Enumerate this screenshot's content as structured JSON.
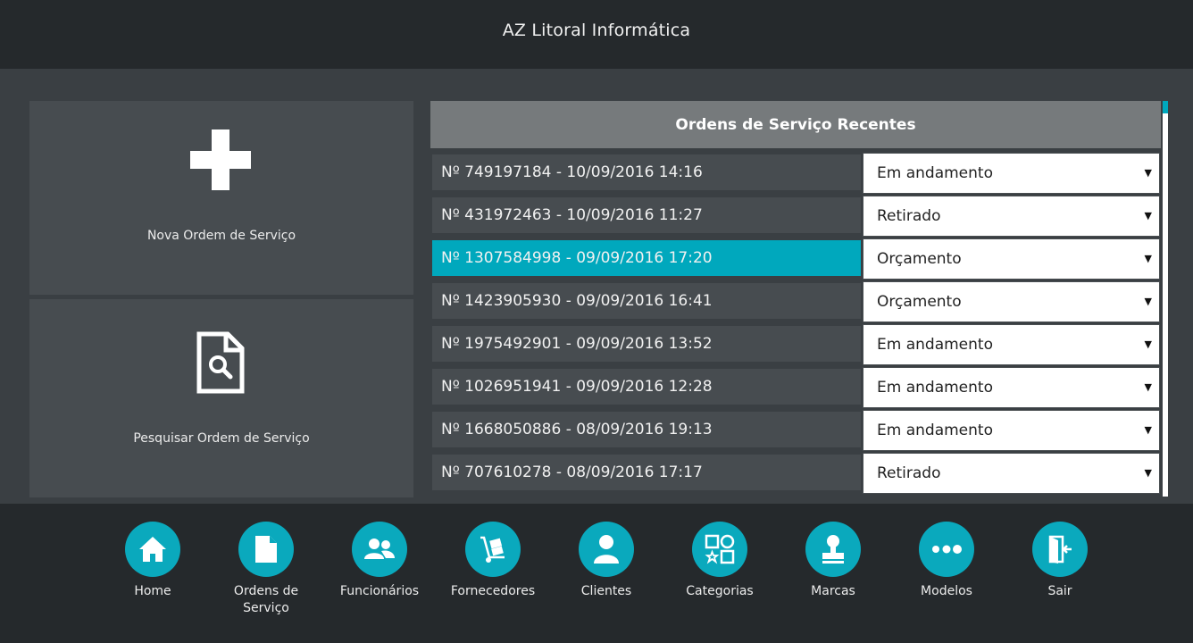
{
  "app": {
    "title": "AZ Litoral Informática"
  },
  "tiles": {
    "new_label": "Nova Ordem de Serviço",
    "search_label": "Pesquisar Ordem de Serviço"
  },
  "orders": {
    "header": "Ordens de Serviço Recentes",
    "rows": [
      {
        "label": "Nº 749197184 - 10/09/2016 14:16",
        "status": "Em andamento"
      },
      {
        "label": "Nº 431972463 - 10/09/2016 11:27",
        "status": "Retirado"
      },
      {
        "label": "Nº 1307584998 - 09/09/2016 17:20",
        "status": "Orçamento"
      },
      {
        "label": "Nº 1423905930 - 09/09/2016 16:41",
        "status": "Orçamento"
      },
      {
        "label": "Nº 1975492901 - 09/09/2016 13:52",
        "status": "Em andamento"
      },
      {
        "label": "Nº 1026951941 - 09/09/2016 12:28",
        "status": "Em andamento"
      },
      {
        "label": "Nº 1668050886 - 08/09/2016 19:13",
        "status": "Em andamento"
      },
      {
        "label": "Nº 707610278 - 08/09/2016 17:17",
        "status": "Retirado"
      }
    ],
    "caret": "▼"
  },
  "nav": {
    "items": [
      {
        "label": "Home",
        "icon": "home-icon"
      },
      {
        "label": "Ordens de Serviço",
        "icon": "document-icon"
      },
      {
        "label": "Funcionários",
        "icon": "users-icon"
      },
      {
        "label": "Fornecedores",
        "icon": "hand-truck-icon"
      },
      {
        "label": "Clientes",
        "icon": "user-icon"
      },
      {
        "label": "Categorias",
        "icon": "categories-icon"
      },
      {
        "label": "Marcas",
        "icon": "stamp-icon"
      },
      {
        "label": "Modelos",
        "icon": "dots-icon"
      },
      {
        "label": "Sair",
        "icon": "exit-icon"
      }
    ]
  },
  "colors": {
    "accent": "#00a8bd",
    "topbar": "#25292c",
    "tile": "#474c50",
    "background": "#3a3f43"
  }
}
